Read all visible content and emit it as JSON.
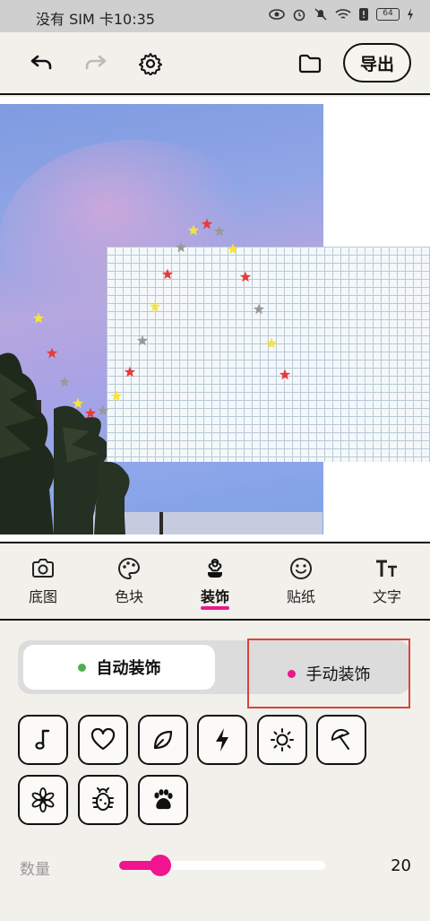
{
  "status_bar": {
    "carrier_time": "没有 SIM 卡10:35",
    "battery": "64"
  },
  "toolbar": {
    "export_label": "导出"
  },
  "tabs": [
    {
      "label": "底图",
      "icon": "camera-icon"
    },
    {
      "label": "色块",
      "icon": "palette-icon"
    },
    {
      "label": "装饰",
      "icon": "flower-icon"
    },
    {
      "label": "贴纸",
      "icon": "smiley-icon"
    },
    {
      "label": "文字",
      "icon": "text-size-icon"
    }
  ],
  "active_tab": "装饰",
  "mode": {
    "auto_label": "自动装饰",
    "manual_label": "手动装饰",
    "auto_dot_color": "#4caf50",
    "manual_dot_color": "#e8198b"
  },
  "decor_icons": [
    "music-note-icon",
    "heart-icon",
    "leaf-icon",
    "lightning-icon",
    "sun-icon",
    "umbrella-icon",
    "snowflake-flower-icon",
    "bug-icon",
    "paw-icon"
  ],
  "quantity": {
    "label": "数量",
    "value": "20",
    "fraction": 0.2
  },
  "colors": {
    "accent": "#f0148f",
    "star_red": "#e63b3b",
    "star_yellow": "#f7e43a",
    "star_gray": "#999999"
  }
}
